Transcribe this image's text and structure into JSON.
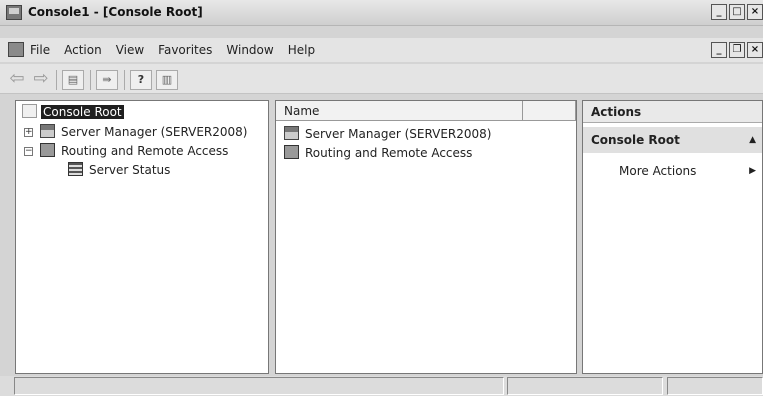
{
  "window": {
    "title": "Console1 - [Console Root]"
  },
  "menu": {
    "items": [
      "File",
      "Action",
      "View",
      "Favorites",
      "Window",
      "Help"
    ]
  },
  "tree": {
    "nodes": [
      {
        "label": "Console Root",
        "selected": true
      },
      {
        "label": "Server Manager (SERVER2008)",
        "expander": "+"
      },
      {
        "label": "Routing and Remote Access",
        "expander": "−"
      },
      {
        "label": "Server Status"
      }
    ]
  },
  "list": {
    "columns": [
      "Name",
      ""
    ],
    "rows": [
      "Server Manager (SERVER2008)",
      "Routing and Remote Access"
    ]
  },
  "actions": {
    "title": "Actions",
    "section": "Console Root",
    "items": [
      "More Actions"
    ]
  }
}
